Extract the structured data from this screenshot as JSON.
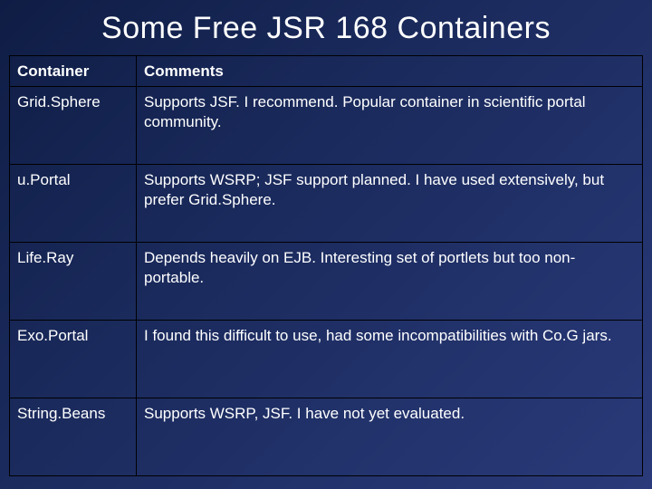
{
  "title": "Some Free JSR 168 Containers",
  "headers": {
    "col1": "Container",
    "col2": "Comments"
  },
  "rows": [
    {
      "name": "Grid.Sphere",
      "comment": "Supports JSF.  I recommend.  Popular container in scientific portal community."
    },
    {
      "name": "u.Portal",
      "comment": "Supports WSRP; JSF support planned. I have used extensively, but prefer Grid.Sphere."
    },
    {
      "name": "Life.Ray",
      "comment": "Depends heavily on EJB.  Interesting set of portlets but too non-portable."
    },
    {
      "name": "Exo.Portal",
      "comment": "I found this difficult to use, had some incompatibilities with Co.G jars."
    },
    {
      "name": "String.Beans",
      "comment": "Supports WSRP, JSF.  I have not yet evaluated."
    }
  ]
}
